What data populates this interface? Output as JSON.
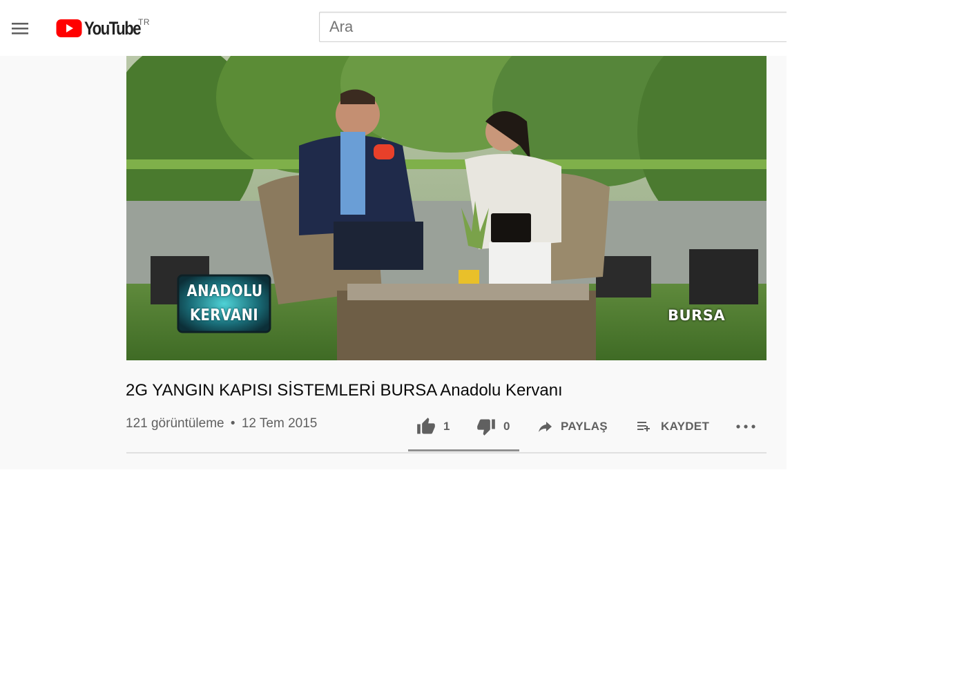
{
  "masthead": {
    "brand_name": "YouTube",
    "country_code": "TR",
    "search_placeholder": "Ara",
    "search_value": ""
  },
  "video": {
    "overlay_logo_line1": "ANADOLU",
    "overlay_logo_line2": "KERVANI",
    "overlay_location": "BURSA",
    "title": "2G YANGIN KAPISI SİSTEMLERİ BURSA Anadolu Kervanı",
    "views": "121 görüntüleme",
    "separator": "•",
    "date": "12 Tem 2015"
  },
  "actions": {
    "like_count": "1",
    "dislike_count": "0",
    "share_label": "PAYLAŞ",
    "save_label": "KAYDET"
  },
  "colors": {
    "brand_red": "#ff0000",
    "text_primary": "#0a0a0a",
    "text_secondary": "#606060",
    "background": "#f9f9f9"
  }
}
